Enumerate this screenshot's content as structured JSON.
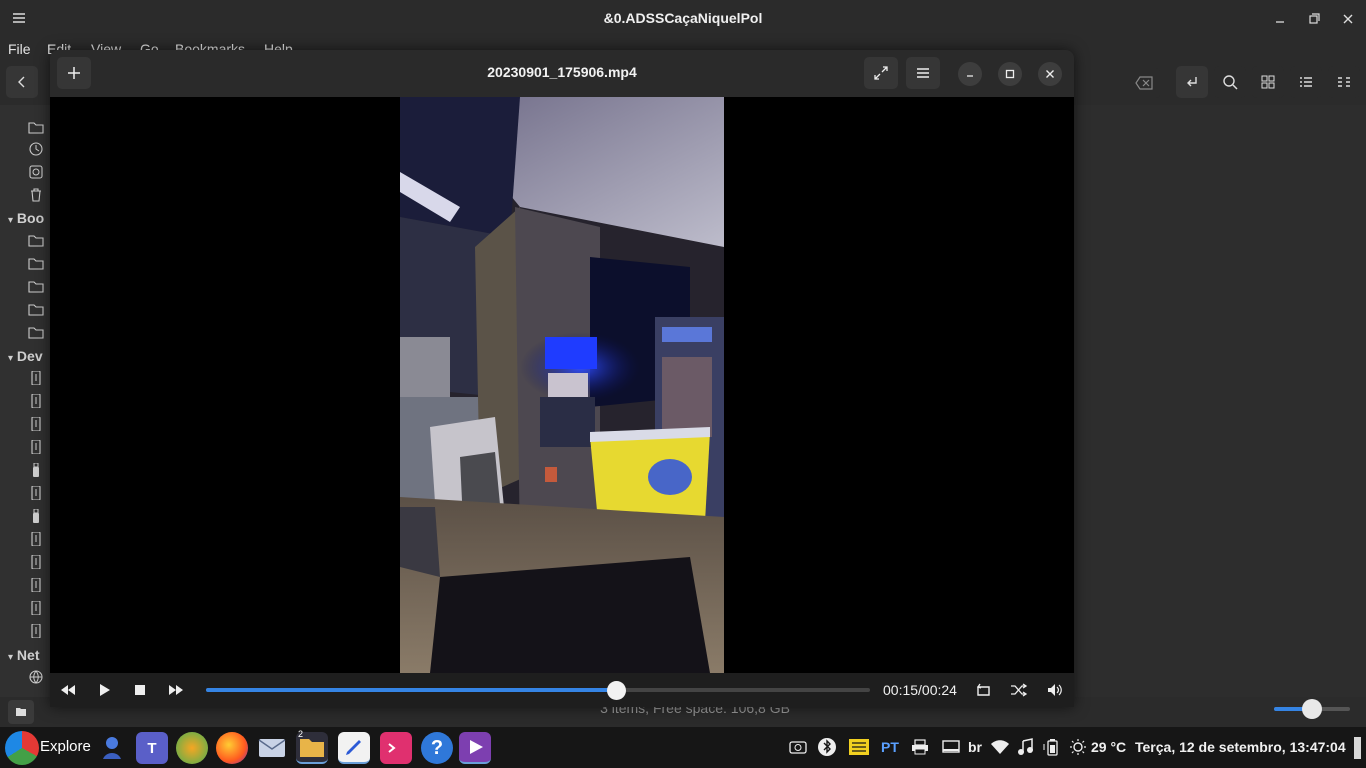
{
  "file_manager": {
    "window_title": "&0.ADSSCaçaNiquelPol",
    "menu": [
      "File",
      "Edit",
      "View",
      "Go",
      "Bookmarks",
      "Help"
    ],
    "sidebar_headings": [
      "Boo",
      "Dev",
      "Net"
    ],
    "status": "3 items, Free space: 106,8 GB",
    "zoom_level": 0.5
  },
  "player": {
    "title": "20230901_175906.mp4",
    "current_time": "00:15",
    "duration": "00:24",
    "time_readout": "00:15/00:24",
    "progress": 0.617,
    "accent_color": "#3584e4"
  },
  "taskbar": {
    "explore_label": "Explore",
    "keyboard_badge": "PT",
    "layout_label": "br",
    "temperature": "29 °C",
    "datetime": "Terça, 12 de setembro, 13:47:04",
    "files_badge": "2"
  }
}
